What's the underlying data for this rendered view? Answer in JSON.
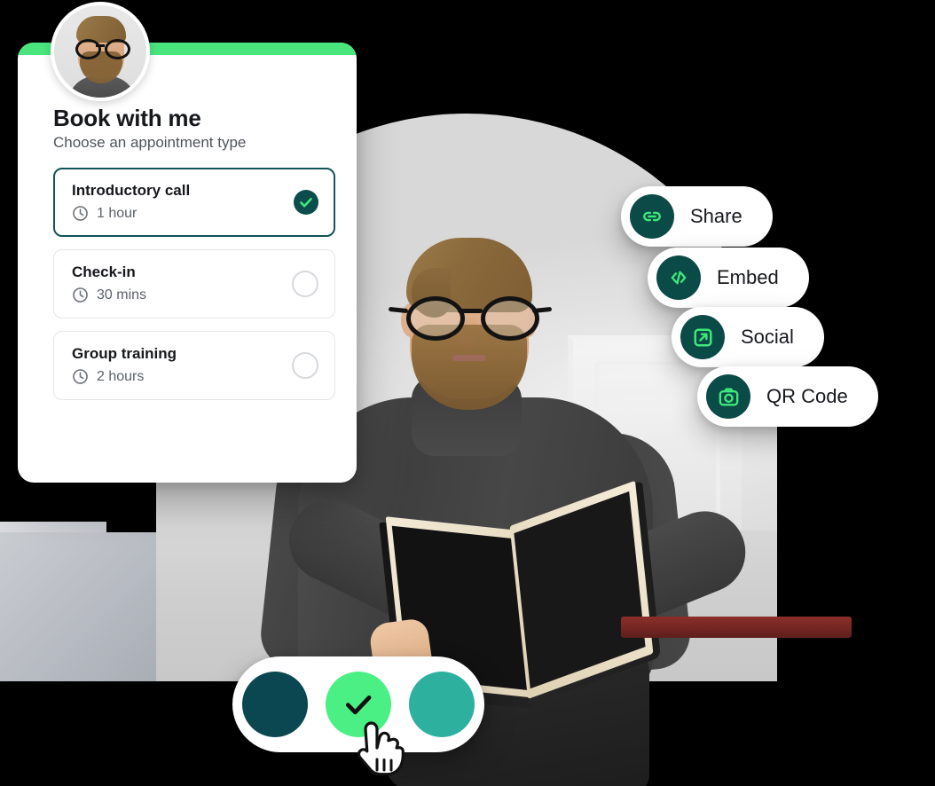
{
  "booking_card": {
    "accent_bar_color": "#4BE57E",
    "avatar": {
      "icon": "user-avatar-photo",
      "alt": "Profile photo"
    },
    "title": "Book with me",
    "subtitle": "Choose an appointment type",
    "appointments": [
      {
        "name": "Introductory call",
        "duration": "1 hour",
        "duration_icon": "clock-icon",
        "selected": true,
        "indicator_icon": "check-circle-icon",
        "indicator_bg": "#0D4C4C",
        "indicator_fg": "#3FE87B",
        "border_color": "#13535A"
      },
      {
        "name": "Check-in",
        "duration": "30 mins",
        "duration_icon": "clock-icon",
        "selected": false,
        "indicator_icon": "radio-unselected-icon",
        "border_color": "#E3E5E8"
      },
      {
        "name": "Group training",
        "duration": "2 hours",
        "duration_icon": "clock-icon",
        "selected": false,
        "indicator_icon": "radio-unselected-icon",
        "border_color": "#E3E5E8"
      }
    ]
  },
  "share_menu": {
    "icon_bg": "#0A4A47",
    "icon_fg": "#3FE87B",
    "items": [
      {
        "label": "Share",
        "icon": "link-icon"
      },
      {
        "label": "Embed",
        "icon": "code-icon"
      },
      {
        "label": "Social",
        "icon": "external-link-icon"
      },
      {
        "label": "QR Code",
        "icon": "camera-qr-icon"
      }
    ]
  },
  "color_picker": {
    "swatches": [
      {
        "name": "dark-teal",
        "color": "#0A4750",
        "selected": false
      },
      {
        "name": "bright-green",
        "color": "#4BF084",
        "selected": true,
        "check_icon": "check-icon"
      },
      {
        "name": "teal",
        "color": "#2EB09F",
        "selected": false
      }
    ],
    "cursor_icon": "pointing-hand-cursor"
  },
  "hero_image": {
    "icon": "photo-man-with-book",
    "alt": "Man with glasses and beard sitting in a chair holding an open book"
  }
}
